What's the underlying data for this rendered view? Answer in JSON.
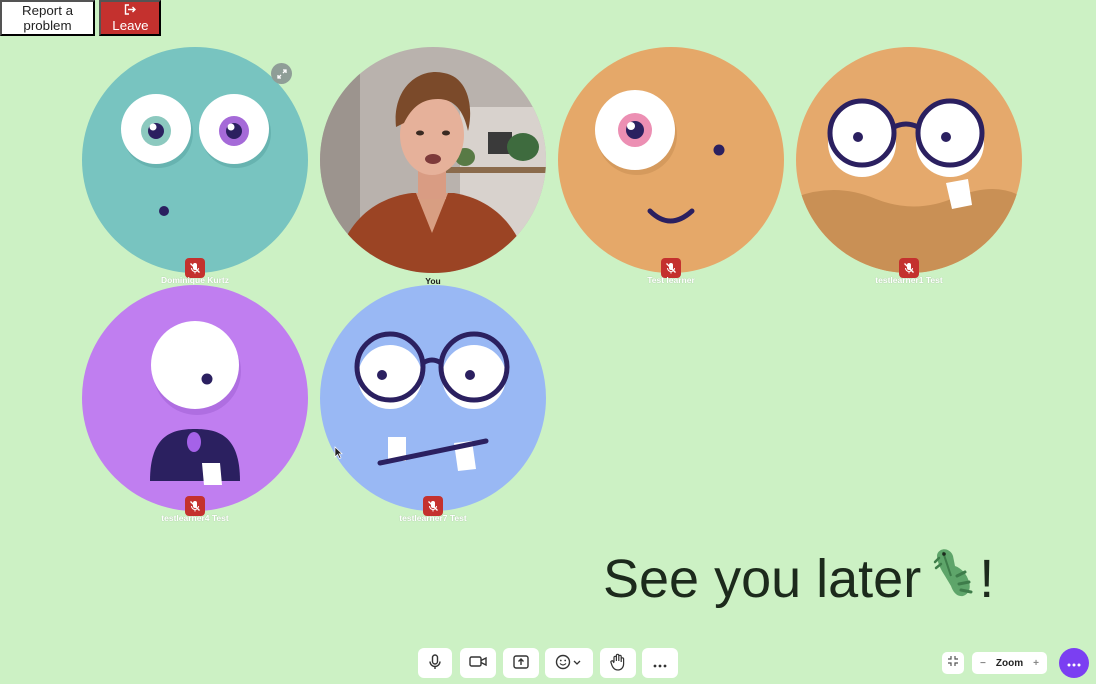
{
  "header": {
    "report_label": "Report a problem",
    "leave_label": "Leave"
  },
  "participants": [
    {
      "name": "Dominique Kurtz",
      "avatar": "teal-two-eyed-monster",
      "muted": true
    },
    {
      "name": "You",
      "avatar": "camera-video-woman",
      "muted": false
    },
    {
      "name": "Test learner",
      "avatar": "orange-one-eyed-monster",
      "muted": true
    },
    {
      "name": "testlearner1 Test",
      "avatar": "tan-glasses-monster",
      "muted": true
    },
    {
      "name": "testlearner4 Test",
      "avatar": "purple-cyclops-monster",
      "muted": true
    },
    {
      "name": "testlearner7 Test",
      "avatar": "blue-glasses-monster",
      "muted": true
    }
  ],
  "message": {
    "text_before": "See you later ",
    "emoji": "crocodile",
    "text_after": "!"
  },
  "toolbar": {
    "buttons": [
      "microphone-icon",
      "camera-icon",
      "share-screen-icon",
      "reactions-icon",
      "raise-hand-icon",
      "more-icon"
    ],
    "zoom_label": "Zoom",
    "zoom_minus": "−",
    "zoom_plus": "+"
  },
  "colors": {
    "background": "#ccf1c4",
    "leave": "#c4312e",
    "mute_badge": "#c4312e",
    "menu_button": "#7b3ff2"
  }
}
